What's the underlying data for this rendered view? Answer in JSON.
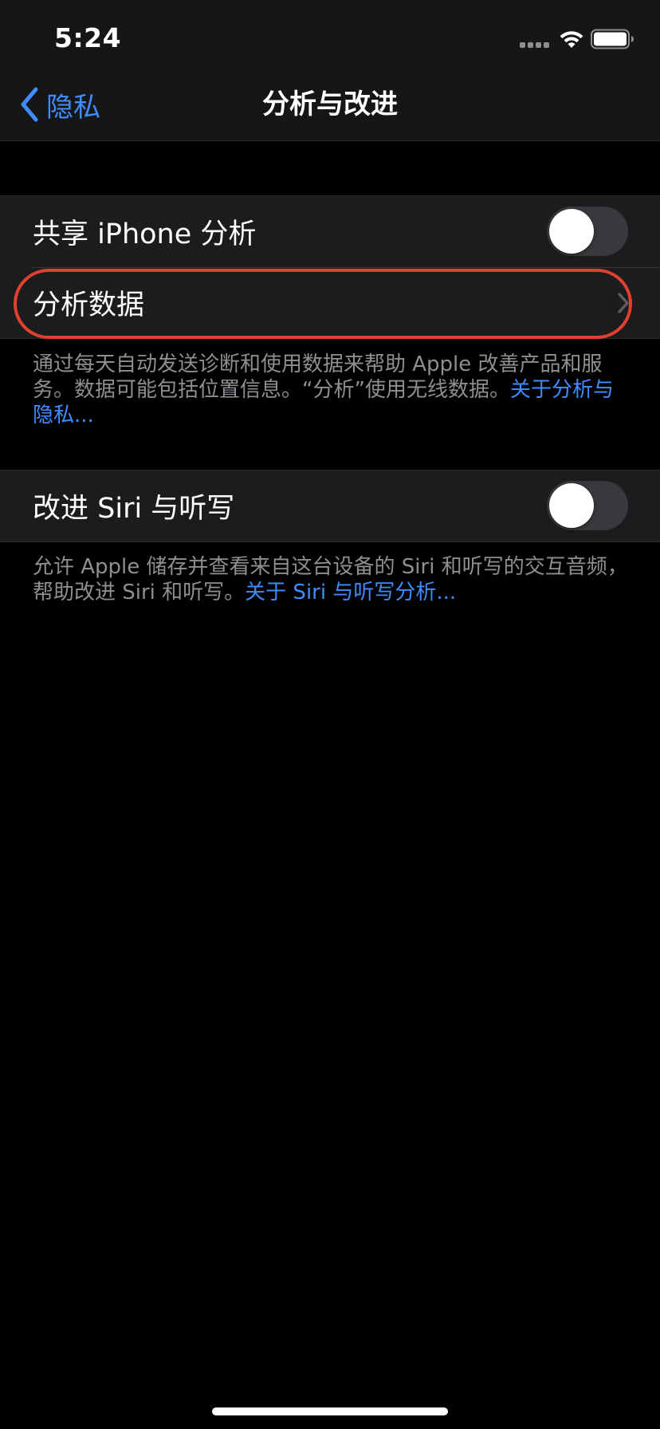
{
  "status_bar": {
    "time": "5:24",
    "signal_icon": "signal-dots-icon",
    "wifi_icon": "wifi-icon",
    "battery_icon": "battery-icon"
  },
  "nav": {
    "back_label": "隐私",
    "back_icon": "chevron-left-icon",
    "title": "分析与改进"
  },
  "section_analytics": {
    "share_label": "共享 iPhone 分析",
    "share_enabled": false,
    "data_label": "分析数据",
    "footer_text": "通过每天自动发送诊断和使用数据来帮助 Apple 改善产品和服务。数据可能包括位置信息。“分析”使用无线数据。",
    "footer_link": "关于分析与隐私..."
  },
  "section_siri": {
    "improve_label": "改进 Siri 与听写",
    "improve_enabled": false,
    "footer_text": "允许 Apple 储存并查看来自这台设备的 Siri 和听写的交互音频，帮助改进 Siri 和听写。",
    "footer_link": "关于 Siri 与听写分析..."
  },
  "colors": {
    "accent": "#3f8cff",
    "highlight": "#e0412e",
    "cell_background": "#1c1c1e",
    "toggle_off": "#39393d",
    "secondary_text": "#8e8e93"
  }
}
